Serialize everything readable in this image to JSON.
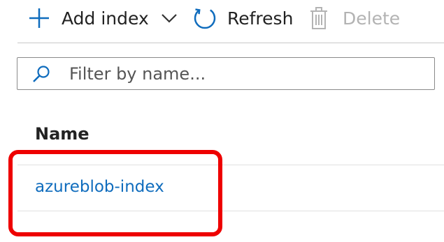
{
  "toolbar": {
    "add_index_label": "Add index",
    "refresh_label": "Refresh",
    "delete_label": "Delete"
  },
  "filter": {
    "placeholder": "Filter by name...",
    "value": ""
  },
  "table": {
    "columns": [
      "Name"
    ],
    "rows": [
      {
        "name": "azureblob-index"
      }
    ]
  },
  "colors": {
    "accent": "#0f6cbd",
    "highlight": "#ee0000",
    "disabled_text": "#b3b3b3"
  },
  "icons": [
    "plus-icon",
    "chevron-down-icon",
    "refresh-icon",
    "trash-icon",
    "search-icon"
  ]
}
